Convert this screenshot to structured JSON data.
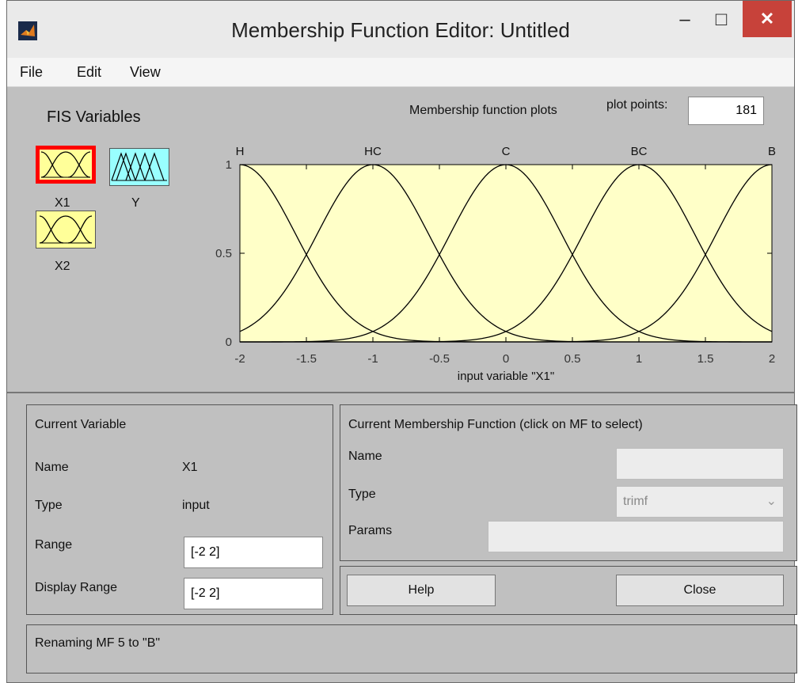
{
  "window": {
    "title": "Membership Function Editor: Untitled",
    "minimize_glyph": "–",
    "maximize_glyph": "□",
    "close_glyph": "✕"
  },
  "menu": [
    "File",
    "Edit",
    "View"
  ],
  "fis_variables": {
    "label": "FIS Variables",
    "vars": [
      {
        "name": "X1",
        "kind": "input",
        "selected": true
      },
      {
        "name": "Y",
        "kind": "output",
        "selected": false
      },
      {
        "name": "X2",
        "kind": "input",
        "selected": false
      }
    ]
  },
  "plot": {
    "title": "Membership function plots",
    "plot_points_label": "plot points:",
    "plot_points_value": "181"
  },
  "chart_data": {
    "type": "line",
    "xlabel": "input variable \"X1\"",
    "xlim": [
      -2,
      2
    ],
    "ylim": [
      0,
      1
    ],
    "xticks": [
      "-2",
      "-1.5",
      "-1",
      "-0.5",
      "0",
      "0.5",
      "1",
      "1.5",
      "2"
    ],
    "yticks": [
      "0",
      "0.5",
      "1"
    ],
    "background": "#ffffc8",
    "series": [
      {
        "name": "H",
        "center": -2
      },
      {
        "name": "HC",
        "center": -1
      },
      {
        "name": "C",
        "center": 0
      },
      {
        "name": "BC",
        "center": 1
      },
      {
        "name": "B",
        "center": 2
      }
    ]
  },
  "current_variable": {
    "title": "Current Variable",
    "name_label": "Name",
    "name_value": "X1",
    "type_label": "Type",
    "type_value": "input",
    "range_label": "Range",
    "range_value": "[-2 2]",
    "display_range_label": "Display Range",
    "display_range_value": "[-2 2]"
  },
  "current_mf": {
    "title": "Current Membership Function (click on MF to select)",
    "name_label": "Name",
    "name_value": "",
    "type_label": "Type",
    "type_value": "trimf",
    "params_label": "Params",
    "params_value": ""
  },
  "buttons": {
    "help": "Help",
    "close": "Close"
  },
  "status": "Renaming MF 5 to \"B\"",
  "colors": {
    "input_var": "#ffff99",
    "output_var": "#99ffff",
    "selected_border": "#ff0000"
  }
}
